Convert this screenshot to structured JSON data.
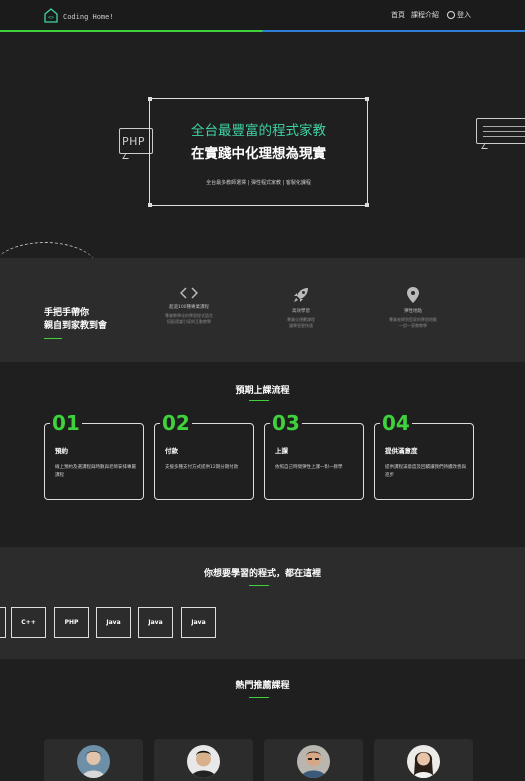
{
  "header": {
    "brand": "Coding Home!",
    "nav": {
      "home": "首頁",
      "courses": "課程介紹",
      "login": "登入"
    }
  },
  "hero": {
    "title_line1": "全台最豐富的程式家教",
    "title_line2": "在實踐中化理想為現實",
    "subtitle": "全台最多教師選擇 | 彈性程式家教 | 客製化課程",
    "bubble_text": "PHP"
  },
  "features": {
    "heading_line1": "手把手帶你",
    "heading_line2": "親自到家教到會",
    "items": [
      {
        "icon": "code-icon",
        "title": "超過100種專業課程",
        "desc_line1": "專業教學化的學習程式語言",
        "desc_line2": "搭配適當引導與互動教學"
      },
      {
        "icon": "rocket-icon",
        "title": "高效學習",
        "desc_line1": "專業化規劃課程",
        "desc_line2": "讓學習更快速"
      },
      {
        "icon": "location-pin-icon",
        "title": "彈性地點",
        "desc_line1": "專業老師到您家的學習地點",
        "desc_line2": "一對一家教教學"
      }
    ]
  },
  "process": {
    "title": "預期上課流程",
    "steps": [
      {
        "num": "01",
        "title": "預約",
        "desc": "線上預約及選課程與時數與老師安排專屬課程"
      },
      {
        "num": "02",
        "title": "付款",
        "desc": "支援多種支付方式提供12期分期付款"
      },
      {
        "num": "03",
        "title": "上課",
        "desc": "依照自己時間彈性上課一對一教學"
      },
      {
        "num": "04",
        "title": "提供滿意度",
        "desc": "提供課程滿意度及回饋讓我們持續改善與進步"
      }
    ]
  },
  "languages": {
    "title": "你想要學習的程式，都在這裡",
    "items": [
      "C++",
      "PHP",
      "Java",
      "Java",
      "Java"
    ]
  },
  "hot": {
    "title": "熱門推薦課程"
  },
  "colors": {
    "accent": "#3fd23c",
    "hero_title": "#3fd2a4",
    "header_line_right": "#2f7fd6"
  }
}
